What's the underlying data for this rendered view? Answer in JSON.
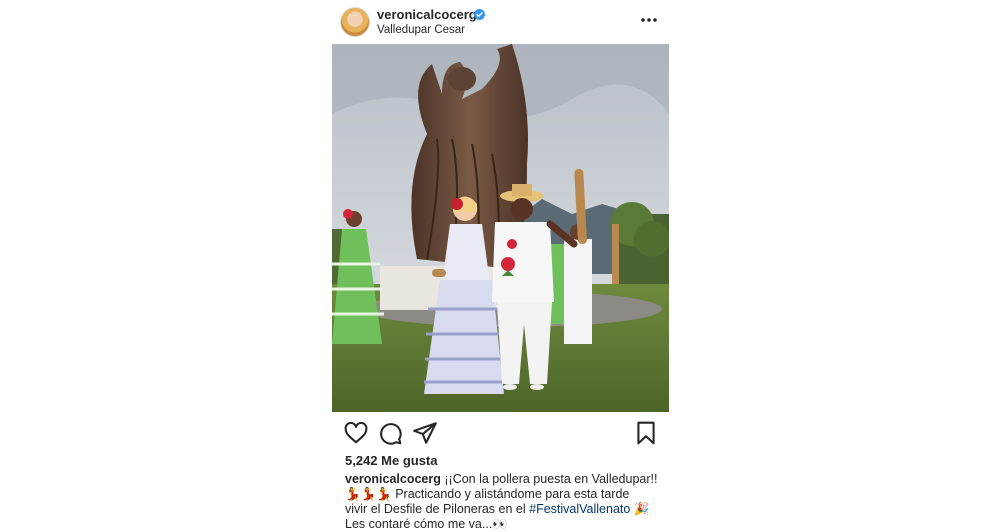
{
  "post": {
    "username": "veronicalcocerg",
    "location": "Valledupar Cesar",
    "likes": "5,242 Me gusta",
    "caption": {
      "username": "veronicalcocerg",
      "line1": "¡¡Con la pollera puesta en Valledupar!!",
      "line2_emoji": "💃💃💃",
      "line2_text": "Practicando y alistándome para esta tarde",
      "line3_prefix": "vivir el Desfile de Piloneras en el",
      "hashtag": "#FestivalVallenato",
      "line3_emoji": "🎉",
      "line4_text": "Les contaré cómo me va...",
      "line4_emoji": "👀"
    }
  },
  "icons": {
    "like": "heart-icon",
    "comment": "comment-icon",
    "share": "share-icon",
    "save": "bookmark-icon",
    "verified": "verified-badge-icon",
    "more": "more-options-icon"
  },
  "colors": {
    "verified": "#3897f0",
    "hashtag": "#00376b",
    "text": "#262626"
  }
}
